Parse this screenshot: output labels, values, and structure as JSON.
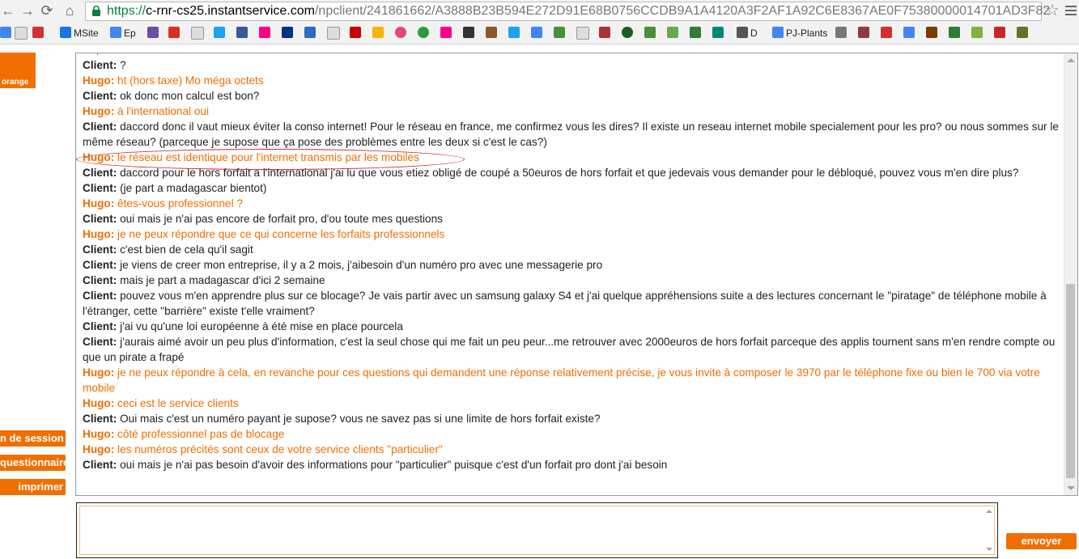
{
  "browser": {
    "url_scheme": "https://",
    "url_host": "c-rnr-cs25.instantservice.com",
    "url_path": "/npclient/241861662/A3888B23B594E272D91E68B0756CCDB9A1A4120A3F2AF1A92C6E8367AE0F75380000014701AD3F82",
    "bookmarks": [
      {
        "label": "MSite",
        "color": "#1a73e8"
      },
      {
        "label": "Ep",
        "color": "#4285f4"
      },
      {
        "label": "D",
        "color": "#555555"
      },
      {
        "label": "PJ-Plants",
        "color": "#4285f4"
      }
    ]
  },
  "sidebar": {
    "logo_text": "orange",
    "buttons": [
      "n de session",
      "questionnaire",
      "imprimer"
    ]
  },
  "colors": {
    "brand": "#f16e00",
    "client_text": "#222222",
    "agent_text": "#f16e00",
    "highlight": "#c0272d"
  },
  "transcript": [
    {
      "speaker": "",
      "role": "client",
      "text": "-   -  ,  -    -  -    -     -   -"
    },
    {
      "speaker": "Client:",
      "role": "client",
      "text": "?"
    },
    {
      "speaker": "Hugo:",
      "role": "agent",
      "text": "ht (hors taxe) Mo méga octets"
    },
    {
      "speaker": "Client:",
      "role": "client",
      "text": "ok donc mon calcul est bon?"
    },
    {
      "speaker": "Hugo:",
      "role": "agent",
      "text": "à l'international oui"
    },
    {
      "speaker": "Client:",
      "role": "client",
      "text": "daccord donc il vaut mieux éviter la conso internet! Pour le réseau en france, me confirmez vous les dires? Il existe un reseau internet mobile specialement pour les pro? ou nous sommes sur le même réseau? (parceque je supose que ça pose des problèmes entre les deux si c'est le cas?)"
    },
    {
      "speaker": "Hugo:",
      "role": "agent",
      "text": "le réseau est identique pour l'internet transmis par les mobiles"
    },
    {
      "speaker": "Client:",
      "role": "client",
      "text": "daccord pour le hors forfait a l'international j'ai lu que vous etiez obligé de coupé a 50euros de hors forfait et que jedevais vous demander pour le débloqué, pouvez vous m'en dire plus?"
    },
    {
      "speaker": "Client:",
      "role": "client",
      "text": "(je part a madagascar bientot)"
    },
    {
      "speaker": "Hugo:",
      "role": "agent",
      "text": "êtes-vous professionnel ?"
    },
    {
      "speaker": "Client:",
      "role": "client",
      "text": "oui mais je n'ai pas encore de forfait pro, d'ou toute mes questions"
    },
    {
      "speaker": "Hugo:",
      "role": "agent",
      "text": "je ne peux répondre que ce qui concerne les forfaits professionnels"
    },
    {
      "speaker": "Client:",
      "role": "client",
      "text": "c'est bien de cela qu'il sagit"
    },
    {
      "speaker": "Client:",
      "role": "client",
      "text": "je viens de creer mon entreprise, il y a 2 mois, j'aibesoin d'un numéro pro avec une messagerie pro"
    },
    {
      "speaker": "Client:",
      "role": "client",
      "text": "mais je part a madagascar d'ici 2 semaine"
    },
    {
      "speaker": "Client:",
      "role": "client",
      "text": "pouvez vous m'en apprendre plus sur ce blocage? Je vais partir avec un samsung galaxy S4 et j'ai quelque appréhensions suite a des lectures concernant le \"piratage\" de téléphone mobile à l'étranger, cette \"barrière\" existe t'elle vraiment?"
    },
    {
      "speaker": "Client:",
      "role": "client",
      "text": "j'ai vu qu'une loi européenne à été mise en place pourcela"
    },
    {
      "speaker": "Client:",
      "role": "client",
      "text": "j'aurais aimé avoir un peu plus d'information, c'est la seul chose qui me fait un peu peur...me retrouver avec 2000euros de hors forfait parceque des applis tournent sans m'en rendre compte ou que un pirate a frapé"
    },
    {
      "speaker": "Hugo:",
      "role": "agent",
      "text": "je ne peux répondre à cela, en revanche pour ces questions qui demandent une réponse relativement précise, je vous invite à composer le 3970 par le téléphone fixe ou bien le 700 via votre mobile"
    },
    {
      "speaker": "Hugo:",
      "role": "agent",
      "text": "ceci est le service clients"
    },
    {
      "speaker": "Client:",
      "role": "client",
      "text": "Oui mais c'est un numéro payant je supose? vous ne savez pas si une limite de hors forfait existe?"
    },
    {
      "speaker": "Hugo:",
      "role": "agent",
      "text": "côté professionnel pas de blocage"
    },
    {
      "speaker": "Hugo:",
      "role": "agent",
      "text": "les numéros précités sont ceux de votre service clients \"particulier\""
    },
    {
      "speaker": "Client:",
      "role": "client",
      "text": "oui mais je n'ai pas besoin d'avoir des informations pour \"particulier\" puisque c'est d'un forfait pro dont j'ai besoin"
    }
  ],
  "composer": {
    "value": "",
    "send_label": "envoyer"
  }
}
